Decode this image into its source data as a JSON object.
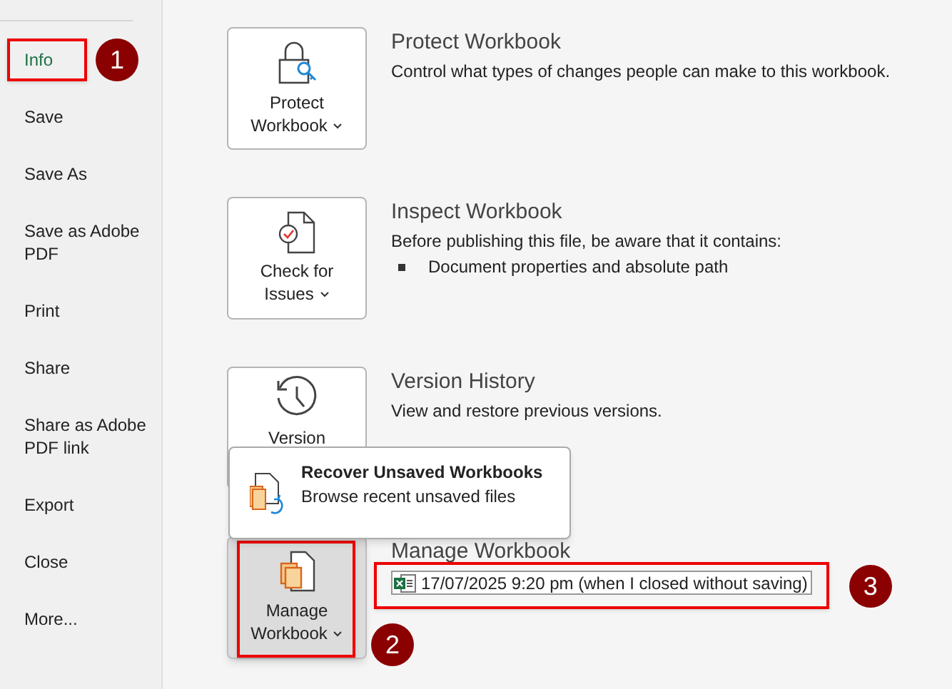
{
  "sidebar": {
    "items": [
      {
        "label": "Info",
        "selected": true,
        "highlighted": true,
        "callout": "1"
      },
      {
        "label": "Save",
        "selected": false,
        "highlighted": false
      },
      {
        "label": "Save As",
        "selected": false,
        "highlighted": false
      },
      {
        "label": "Save as Adobe PDF",
        "selected": false,
        "highlighted": false
      },
      {
        "label": "Print",
        "selected": false,
        "highlighted": false
      },
      {
        "label": "Share",
        "selected": false,
        "highlighted": false
      },
      {
        "label": "Share as Adobe PDF link",
        "selected": false,
        "highlighted": false
      },
      {
        "label": "Export",
        "selected": false,
        "highlighted": false
      },
      {
        "label": "Close",
        "selected": false,
        "highlighted": false
      },
      {
        "label": "More...",
        "selected": false,
        "highlighted": false
      }
    ]
  },
  "sections": [
    {
      "kind": "protect",
      "button_label": "Protect Workbook",
      "dropdown": true,
      "pressed": false,
      "highlighted": false,
      "title": "Protect Workbook",
      "description": "Control what types of changes people can make to this workbook."
    },
    {
      "kind": "inspect",
      "button_label": "Check for Issues",
      "dropdown": true,
      "pressed": false,
      "highlighted": false,
      "title": "Inspect Workbook",
      "description": "Before publishing this file, be aware that it contains:",
      "bullets": [
        "Document properties and absolute path"
      ]
    },
    {
      "kind": "versions",
      "button_label": "Version",
      "dropdown": false,
      "pressed": false,
      "highlighted": false,
      "title": "Version History",
      "description": "View and restore previous versions."
    },
    {
      "kind": "manage",
      "button_label": "Manage Workbook",
      "dropdown": true,
      "pressed": true,
      "highlighted": true,
      "callout": "2",
      "title": "Manage Workbook",
      "files": [
        {
          "label": "17/07/2025 9:20 pm (when I closed without saving)",
          "highlighted": true,
          "callout": "3"
        }
      ]
    }
  ],
  "popup_menu": {
    "title": "Recover Unsaved Workbooks",
    "subtitle": "Browse recent unsaved files"
  }
}
